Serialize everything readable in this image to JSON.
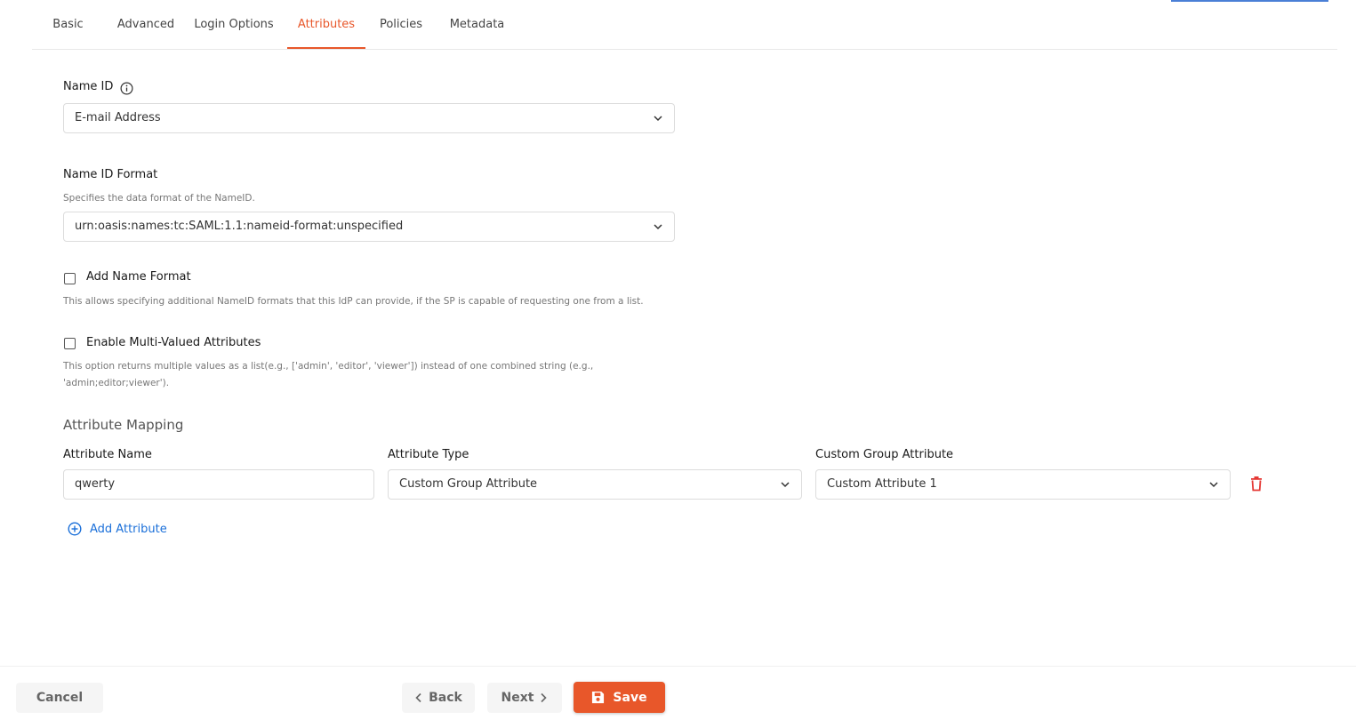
{
  "tabs": [
    {
      "label": "Basic"
    },
    {
      "label": "Advanced"
    },
    {
      "label": "Login Options"
    },
    {
      "label": "Attributes",
      "active": true
    },
    {
      "label": "Policies"
    },
    {
      "label": "Metadata"
    }
  ],
  "name_id": {
    "label": "Name ID",
    "value": "E-mail Address"
  },
  "name_id_format": {
    "label": "Name ID Format",
    "help": "Specifies the data format of the NameID.",
    "value": "urn:oasis:names:tc:SAML:1.1:nameid-format:unspecified"
  },
  "add_name_format": {
    "label": "Add Name Format",
    "checked": false,
    "help": "This allows specifying additional NameID formats that this IdP can provide, if the SP is capable of requesting one from a list."
  },
  "multi_valued": {
    "label": "Enable Multi-Valued Attributes",
    "checked": false,
    "help_line1": "This option returns multiple values as a list(e.g., ['admin', 'editor', 'viewer']) instead of one combined string (e.g.,",
    "help_line2": "'admin;editor;viewer')."
  },
  "attribute_mapping": {
    "title": "Attribute Mapping",
    "col_name": "Attribute Name",
    "col_type": "Attribute Type",
    "col_custom": "Custom Group Attribute",
    "rows": [
      {
        "name": "qwerty",
        "type": "Custom Group Attribute",
        "custom": "Custom Attribute 1"
      }
    ],
    "add_label": "Add Attribute"
  },
  "footer": {
    "cancel": "Cancel",
    "back": "Back",
    "next": "Next",
    "save": "Save"
  },
  "colors": {
    "accent": "#e8572a",
    "link": "#1a6fd9",
    "delete": "#e53935"
  }
}
